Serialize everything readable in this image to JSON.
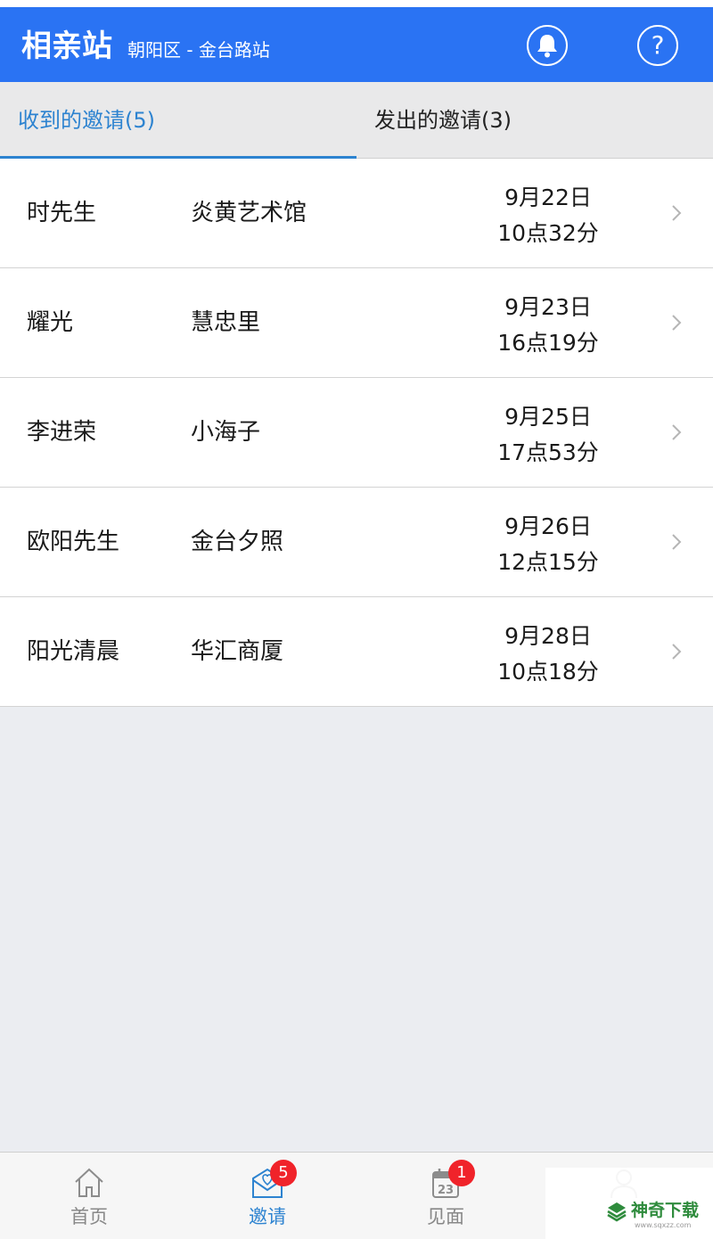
{
  "header": {
    "title": "相亲站",
    "subtitle": "朝阳区 - 金台路站",
    "bell_icon": "bell-icon",
    "help_icon": "help-icon",
    "help_glyph": "?"
  },
  "tabs": [
    {
      "label": "收到的邀请(5)",
      "active": true
    },
    {
      "label": "发出的邀请(3)",
      "active": false
    }
  ],
  "invitations": [
    {
      "name": "时先生",
      "place": "炎黄艺术馆",
      "date": "9月22日",
      "time": "10点32分"
    },
    {
      "name": "耀光",
      "place": "慧忠里",
      "date": "9月23日",
      "time": "16点19分"
    },
    {
      "name": "李进荣",
      "place": "小海子",
      "date": "9月25日",
      "time": "17点53分"
    },
    {
      "name": "欧阳先生",
      "place": "金台夕照",
      "date": "9月26日",
      "time": "12点15分"
    },
    {
      "name": "阳光清晨",
      "place": "华汇商厦",
      "date": "9月28日",
      "time": "10点18分"
    }
  ],
  "tabbar": {
    "items": [
      {
        "label": "首页",
        "icon": "home-icon"
      },
      {
        "label": "邀请",
        "icon": "invite-mail-icon",
        "badge": "5",
        "active": true
      },
      {
        "label": "见面",
        "icon": "calendar-icon",
        "badge": "1",
        "calendar_day": "23"
      },
      {
        "label": "",
        "icon": "profile-icon"
      }
    ]
  },
  "watermark": {
    "text": "神奇下载",
    "url": "www.sqxzz.com"
  },
  "colors": {
    "brand": "#2a73f3",
    "accent": "#2d83d0",
    "badge": "#f0232a",
    "background": "#ebedf1"
  }
}
